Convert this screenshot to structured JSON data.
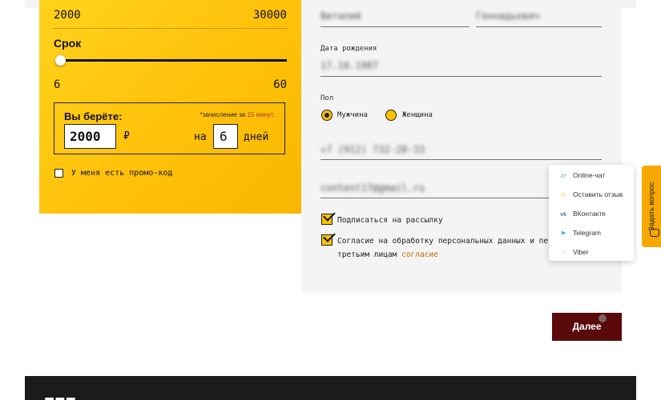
{
  "calculator": {
    "sum_min": "2000",
    "sum_max": "30000",
    "term_label": "Срок",
    "term_value": 6,
    "days_min": "6",
    "days_max": "60",
    "take_label": "Вы берёте:",
    "credit_note_prefix": "*зачисление за",
    "credit_note_time": "15 минут.",
    "amount_value": "2000",
    "currency": "₽",
    "for_label": "на",
    "days_value": "6",
    "days_label": "дней",
    "promo_label": "У меня есть промо-код"
  },
  "form": {
    "first_name": "Виталий",
    "patronymic": "Геннадьевич",
    "birth_label": "Дата рождения",
    "birth_value": "17.10.1987",
    "gender_label": "Пол",
    "gender_male": "Мужчина",
    "gender_female": "Женщина",
    "phone_value": "+7 (912) 732-28-33",
    "email_value": "content17@gmail.ru",
    "subscribe_label": "Подписаться на рассылку",
    "consent_label": "Согласие на обработку персональных данных и пе",
    "consent_line2": "третьим лицам",
    "consent_link": "согласие"
  },
  "chat_menu": [
    {
      "label": "Online-чат",
      "icon": "chat-icon"
    },
    {
      "label": "Оставить отзыв",
      "icon": "star-icon"
    },
    {
      "label": "ВКонтакте",
      "icon": "vk-icon"
    },
    {
      "label": "Telegram",
      "icon": "telegram-icon"
    },
    {
      "label": "Viber",
      "icon": "viber-icon"
    }
  ],
  "side_tab_label": "Задать вопрос",
  "next_button": "Далее",
  "colors": {
    "accent_yellow": "#ffc10a",
    "button_dark_red": "#5a0a0a",
    "form_bg": "#f4f4f4",
    "footer": "#1b1b1b"
  }
}
